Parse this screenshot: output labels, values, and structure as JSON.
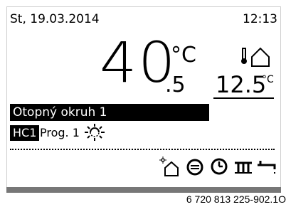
{
  "status": {
    "date": "St, 19.03.2014",
    "time": "12:13"
  },
  "room_temp": {
    "whole": "40",
    "decimal": ".5",
    "unit": "°C"
  },
  "outdoor": {
    "value": "12.5",
    "unit": "°C",
    "icon": "outdoor-thermometer-house-icon"
  },
  "circuit": {
    "name": "Otopný okruh 1"
  },
  "program": {
    "badge": "HC1",
    "name": "Prog. 1",
    "mode_icon": "sun-icon"
  },
  "bottom_icons": [
    "dhw-house-icon",
    "hot-water-icon",
    "clock-icon",
    "radiator-icon",
    "tap-icon"
  ],
  "caption": "6 720 813 225-902.1O"
}
